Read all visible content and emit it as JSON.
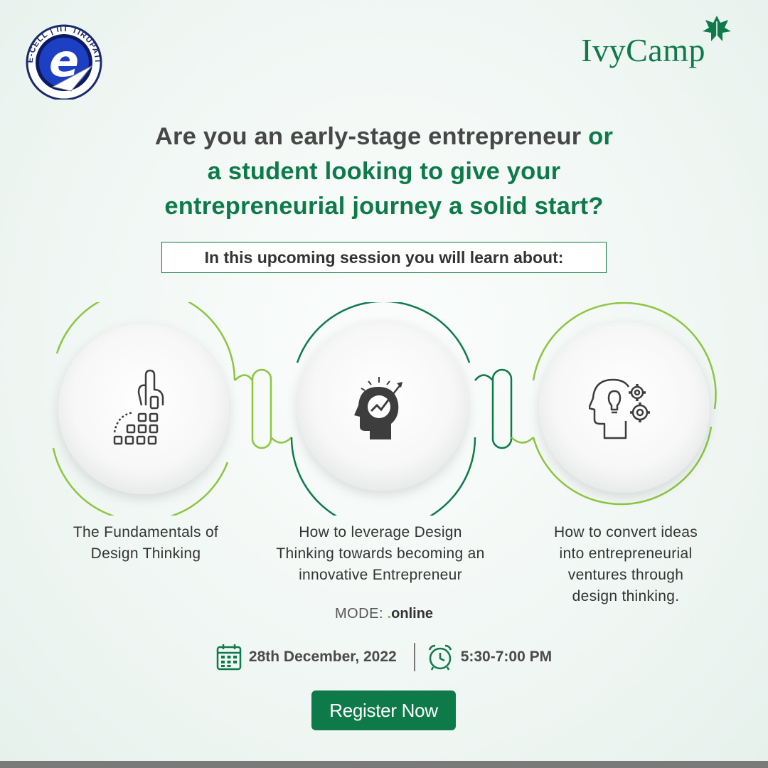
{
  "logo": {
    "ring_text": "E-CELL | IIT TIRUPATI",
    "icon": "ecell-e-logo"
  },
  "brand": {
    "name": "IvyCamp",
    "icon": "ivy-leaf-icon"
  },
  "headline": {
    "part1": "Are you an early-stage entrepreneur",
    "part2": "or",
    "part3": "a student looking to give your",
    "part4": "entrepreneurial journey a solid start?"
  },
  "session_intro": "In this upcoming session you will learn about:",
  "topics": [
    {
      "icon": "hand-building-blocks-icon",
      "line1": "The Fundamentals of",
      "line2": "Design Thinking"
    },
    {
      "icon": "head-growth-chart-icon",
      "line1": "How to leverage Design",
      "line2": "Thinking towards becoming an",
      "line3": "innovative Entrepreneur"
    },
    {
      "icon": "head-lightbulb-gears-icon",
      "line1": "How to convert ideas",
      "line2": "into entrepreneurial",
      "line3": "ventures through",
      "line4": "design thinking."
    }
  ],
  "mode": {
    "label": "MODE:",
    "dot": ".",
    "value": "online"
  },
  "date": {
    "icon": "calendar-icon",
    "text": "28th December, 2022"
  },
  "time": {
    "icon": "alarm-clock-icon",
    "text": "5:30-7:00 PM"
  },
  "register": {
    "label": "Register Now"
  },
  "colors": {
    "primary_green": "#0e7a4a",
    "light_green": "#8cc63f",
    "text_dark": "#474747"
  }
}
